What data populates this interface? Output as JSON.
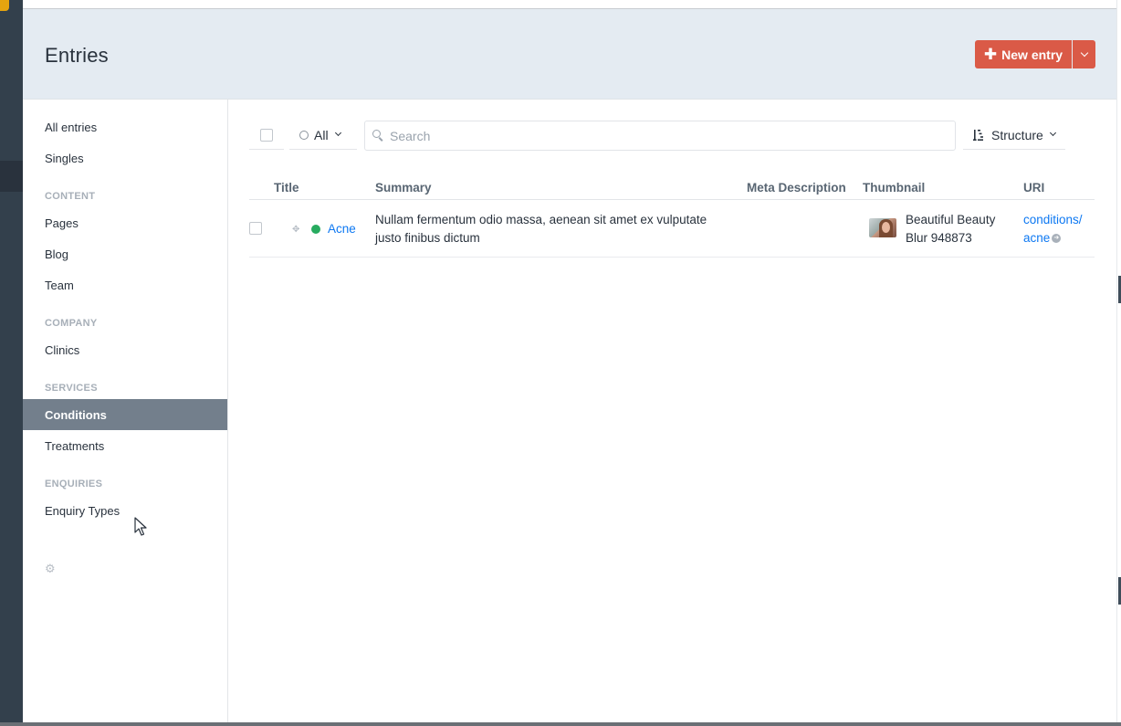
{
  "header": {
    "title": "Entries",
    "new_entry_label": "New entry"
  },
  "sidebar": {
    "items": {
      "all_entries": "All entries",
      "singles": "Singles",
      "pages": "Pages",
      "blog": "Blog",
      "team": "Team",
      "clinics": "Clinics",
      "conditions": "Conditions",
      "treatments": "Treatments",
      "enquiry_types": "Enquiry Types"
    },
    "headings": {
      "content": "CONTENT",
      "company": "COMPANY",
      "services": "SERVICES",
      "enquiries": "ENQUIRIES"
    },
    "active": "Conditions"
  },
  "toolbar": {
    "status_filter": "All",
    "search_placeholder": "Search",
    "search_value": "",
    "view_mode": "Structure"
  },
  "table": {
    "columns": [
      "Title",
      "Summary",
      "Meta Description",
      "Thumbnail",
      "URI"
    ],
    "rows": [
      {
        "title": "Acne",
        "status_color": "#27ab5f",
        "summary_line1": "Nullam fermentum odio massa, aenean sit amet ex vulputate",
        "summary_line2": "justo finibus dictum",
        "meta_description": "",
        "thumbnail_line1": "Beautiful Beauty",
        "thumbnail_line2": "Blur 948873",
        "uri_line1": "conditions/",
        "uri_line2": "acne"
      }
    ]
  },
  "colors": {
    "accent": "#da5a47",
    "link": "#0d78f2",
    "sidebar_active": "#737f8c",
    "header_bg": "#e4ebf2"
  }
}
